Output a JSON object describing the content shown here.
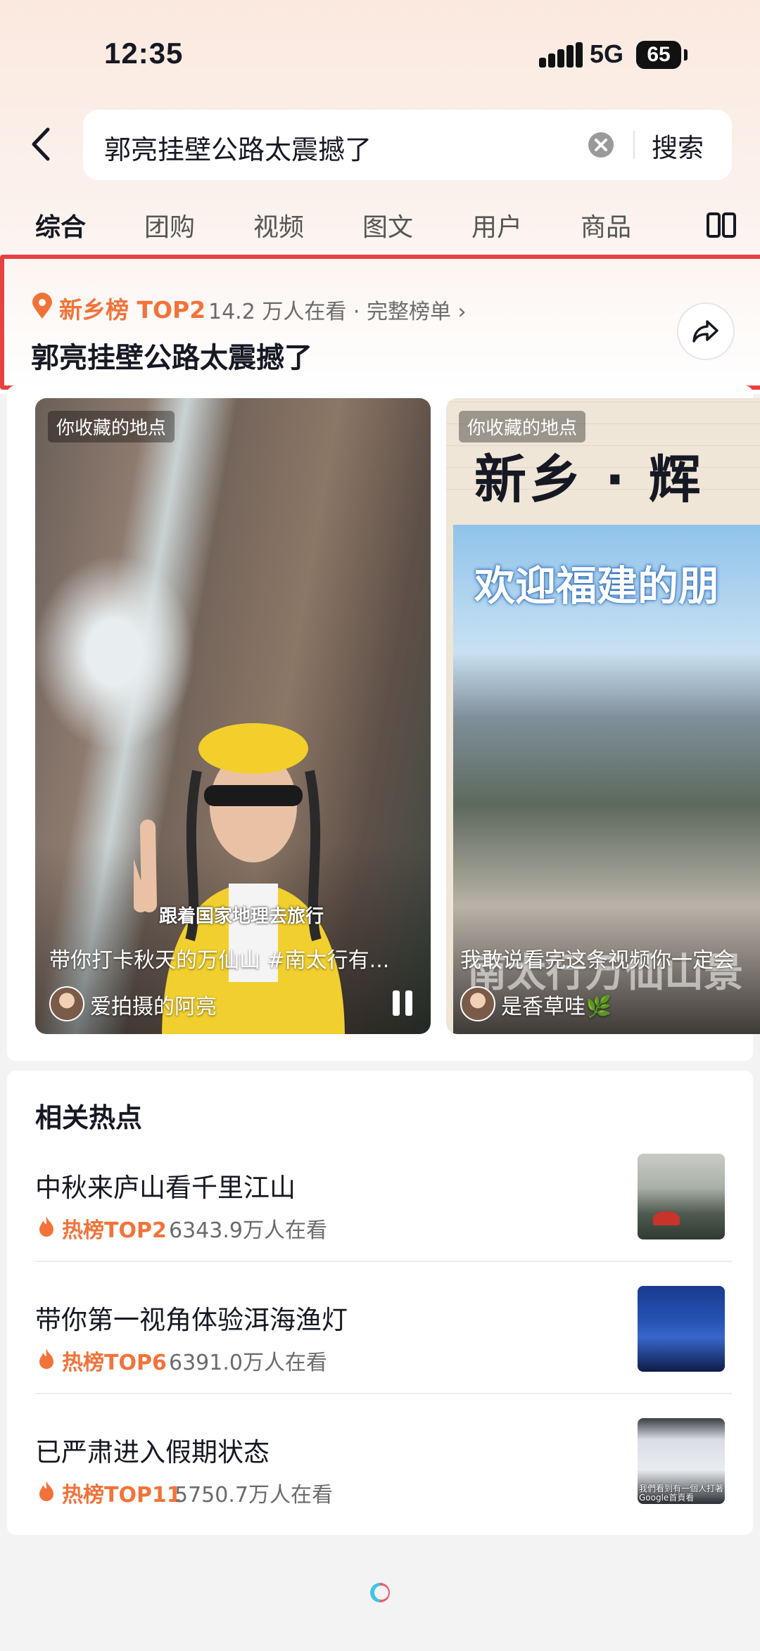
{
  "status_bar": {
    "time": "12:35",
    "network": "5G",
    "battery": "65"
  },
  "search": {
    "query": "郭亮挂壁公路太震撼了",
    "button_label": "搜索"
  },
  "tabs": [
    {
      "label": "综合",
      "active": true
    },
    {
      "label": "团购",
      "active": false
    },
    {
      "label": "视频",
      "active": false
    },
    {
      "label": "图文",
      "active": false
    },
    {
      "label": "用户",
      "active": false
    },
    {
      "label": "商品",
      "active": false
    }
  ],
  "rank_card": {
    "tag": "新乡榜 TOP2",
    "meta": "14.2 万人在看 · 完整榜单 ›",
    "title": "郭亮挂壁公路太震撼了",
    "accent_color": "#f2733a",
    "highlight_border_color": "#e94040"
  },
  "videos": [
    {
      "badge": "你收藏的地点",
      "overlay_text": "跟着国家地理去旅行",
      "description": "带你打卡秋天的万仙山 #南太行有...",
      "author": "爱拍摄的阿亮",
      "playing": true
    },
    {
      "badge": "你收藏的地点",
      "banner_text": "新乡 · 辉",
      "photo_caption": "欢迎福建的朋",
      "photo_caption_bottom": "南太行万仙山景",
      "description": "我敢说看完这条视频你一定会",
      "author": "是香草哇🌿"
    }
  ],
  "related": {
    "title": "相关热点",
    "items": [
      {
        "title": "中秋来庐山看千里江山",
        "tag": "热榜TOP2",
        "views": "6343.9万人在看"
      },
      {
        "title": "带你第一视角体验洱海渔灯",
        "tag": "热榜TOP6",
        "views": "6391.0万人在看"
      },
      {
        "title": "已严肃进入假期状态",
        "tag": "热榜TOP11",
        "views": "5750.7万人在看",
        "thumb_text": "我們看到有一個人打著Google首頁看"
      }
    ]
  }
}
